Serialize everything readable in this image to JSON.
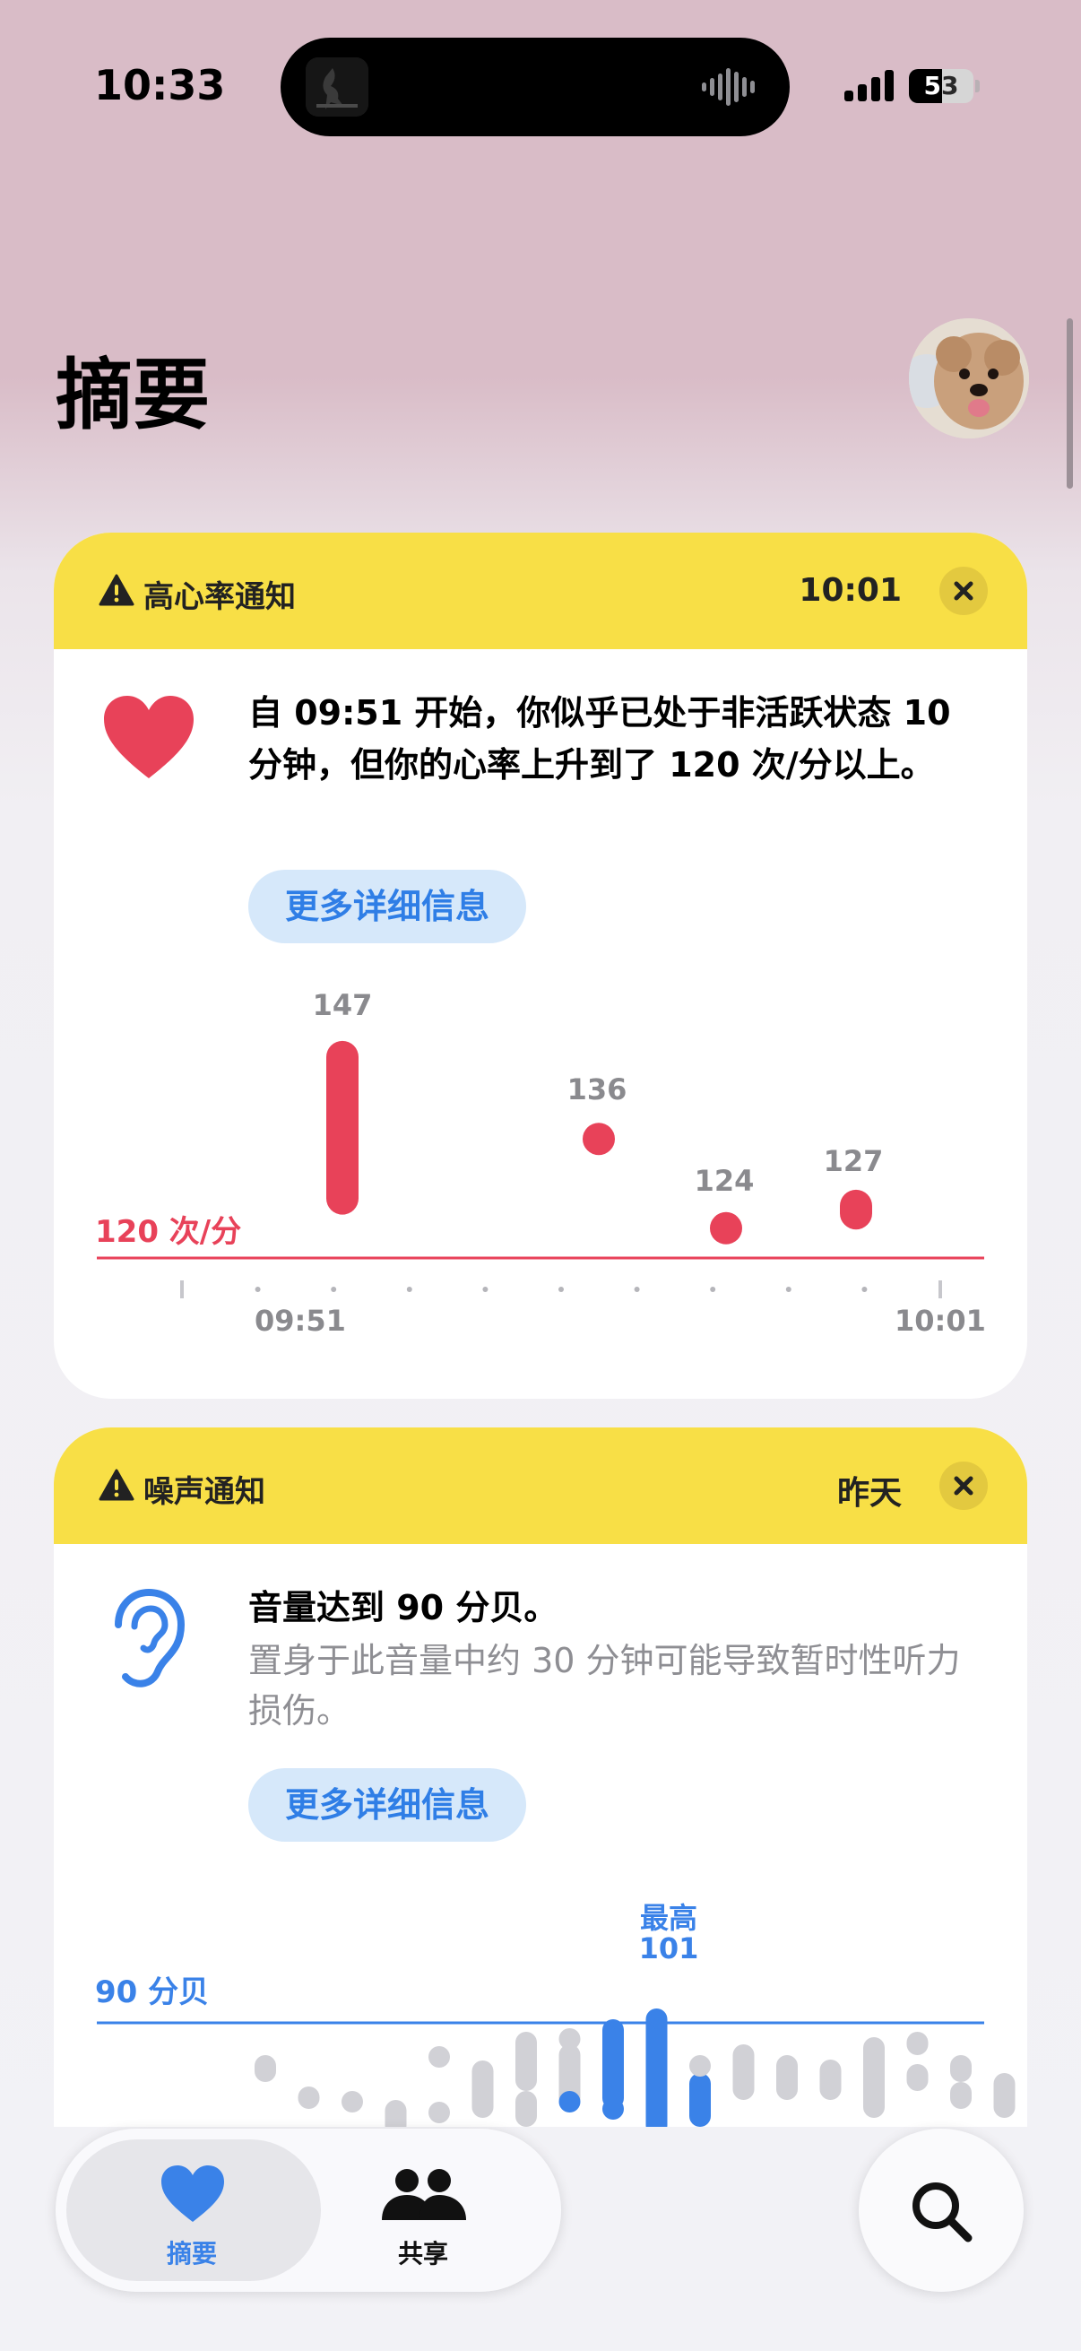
{
  "status_bar": {
    "time": "10:33",
    "battery": "53"
  },
  "header": {
    "title": "摘要"
  },
  "heart_card": {
    "title": "高心率通知",
    "time": "10:01",
    "message": "自 09:51 开始，你似乎已处于非活跃状态 10 分钟，但你的心率上升到了 120 次/分以上。",
    "button_label": "更多详细信息",
    "threshold_label": "120 次/分",
    "x_start_label": "09:51",
    "x_end_label": "10:01",
    "colors": {
      "accent": "#e84259",
      "header": "#f8df46"
    }
  },
  "noise_card": {
    "title": "噪声通知",
    "time": "昨天",
    "message": "音量达到 90 分贝。",
    "sub_message": "置身于此音量中约 30 分钟可能导致暂时性听力损伤。",
    "button_label": "更多详细信息",
    "threshold_label": "90 分贝",
    "peak_label": "最高",
    "peak_value": "101",
    "colors": {
      "accent": "#3a82e8",
      "header": "#f8df46"
    }
  },
  "tab_bar": {
    "tabs": [
      {
        "label": "摘要",
        "icon": "heart-icon",
        "active": true
      },
      {
        "label": "共享",
        "icon": "people-icon",
        "active": false
      }
    ],
    "search_icon": "search-icon"
  },
  "chart_data": [
    {
      "type": "scatter",
      "title": "",
      "threshold": 120,
      "x_labels": [
        "09:51",
        "10:01"
      ],
      "points": [
        {
          "label": "147",
          "min": 128,
          "max": 147
        },
        {
          "label": "136",
          "min": 136,
          "max": 136
        },
        {
          "label": "124",
          "min": 124,
          "max": 124
        },
        {
          "label": "127",
          "min": 126,
          "max": 127
        }
      ]
    },
    {
      "type": "bar",
      "title": "",
      "threshold": 90,
      "peak": 101
    }
  ]
}
